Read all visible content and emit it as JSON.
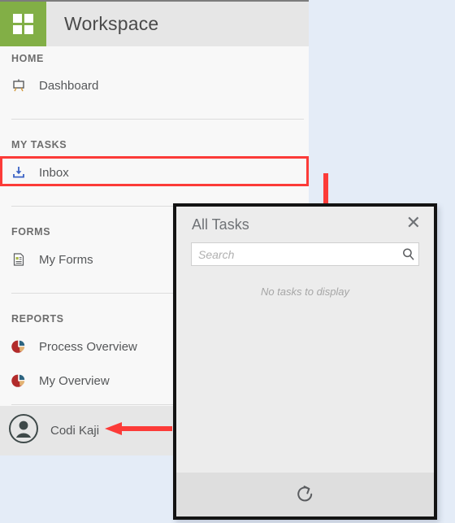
{
  "app": {
    "title": "Workspace",
    "logo_icon": "four-squares-logo-icon",
    "accent_color": "#82af46"
  },
  "sidebar": {
    "sections": [
      {
        "label": "HOME",
        "items": [
          {
            "label": "Dashboard",
            "icon": "presentation-board-icon"
          }
        ]
      },
      {
        "label": "MY TASKS",
        "items": [
          {
            "label": "Inbox",
            "icon": "inbox-tray-icon",
            "highlighted": true
          }
        ]
      },
      {
        "label": "FORMS",
        "items": [
          {
            "label": "My Forms",
            "icon": "form-document-icon"
          }
        ]
      },
      {
        "label": "REPORTS",
        "items": [
          {
            "label": "Process Overview",
            "icon": "pie-chart-icon"
          },
          {
            "label": "My Overview",
            "icon": "pie-chart-icon"
          }
        ]
      }
    ],
    "user": {
      "name": "Codi Kaji",
      "avatar_icon": "user-avatar-icon"
    }
  },
  "dialog": {
    "title": "All Tasks",
    "close_icon": "close-icon",
    "search": {
      "placeholder": "Search",
      "value": "",
      "icon": "search-icon"
    },
    "empty_message": "No tasks to display",
    "footer": {
      "refresh_icon": "refresh-icon"
    }
  },
  "annotations": {
    "highlight_color": "#fc3b38",
    "arrows": [
      {
        "name": "arrow-down-to-dialog",
        "direction": "down"
      },
      {
        "name": "arrow-left-to-user",
        "direction": "left"
      }
    ]
  }
}
